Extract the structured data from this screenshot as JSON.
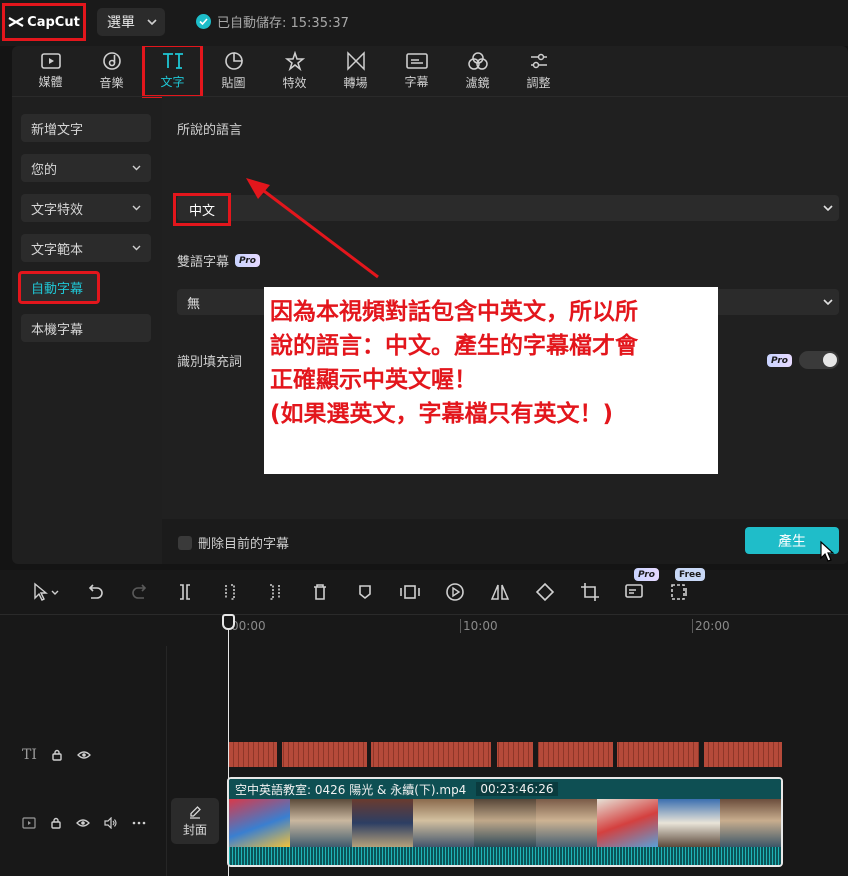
{
  "app": {
    "logo_text": "CapCut",
    "menu_label": "選單",
    "save_status": "已自動儲存: 15:35:37"
  },
  "tabs": [
    {
      "label": "媒體",
      "icon": "media-icon"
    },
    {
      "label": "音樂",
      "icon": "music-icon"
    },
    {
      "label": "文字",
      "icon": "text-icon",
      "active": true
    },
    {
      "label": "貼圖",
      "icon": "sticker-icon"
    },
    {
      "label": "特效",
      "icon": "effects-icon"
    },
    {
      "label": "轉場",
      "icon": "transition-icon"
    },
    {
      "label": "字幕",
      "icon": "captions-icon"
    },
    {
      "label": "濾鏡",
      "icon": "filter-icon"
    },
    {
      "label": "調整",
      "icon": "adjust-icon"
    }
  ],
  "categories": [
    {
      "label": "新增文字"
    },
    {
      "label": "您的",
      "has_chevron": true
    },
    {
      "label": "文字特效",
      "has_chevron": true
    },
    {
      "label": "文字範本",
      "has_chevron": true
    },
    {
      "label": "自動字幕",
      "active": true
    },
    {
      "label": "本機字幕"
    }
  ],
  "auto_caption": {
    "language_label": "所說的語言",
    "language_value": "中文",
    "bilingual_label": "雙語字幕",
    "bilingual_value": "無",
    "filler_label": "識別填充詞",
    "delete_label": "刪除目前的字幕",
    "generate_label": "產生",
    "pro_badge": "Pro",
    "filler_toggle_on": false
  },
  "annotation": {
    "lines": [
      "因為本視頻對話包含中英文，所以所",
      "說的語言：中文。產生的字幕檔才會",
      "正確顯示中英文喔！",
      "(如果選英文，字幕檔只有英文！)"
    ]
  },
  "timeline": {
    "ruler": [
      "00:00",
      "10:00",
      "20:00"
    ],
    "pro_badge": "Pro",
    "free_badge": "Free",
    "clip_name": "空中英語教室: 0426 陽光 & 永續(下).mp4",
    "clip_duration": "00:23:46:26",
    "cover_label": "封面",
    "text_track_icon": "TI"
  },
  "colors": {
    "accent": "#1fc6d4",
    "annotation_red": "#e3161c",
    "subtitle_clip": "#b54a3a",
    "video_clip": "#0f5a5e"
  }
}
